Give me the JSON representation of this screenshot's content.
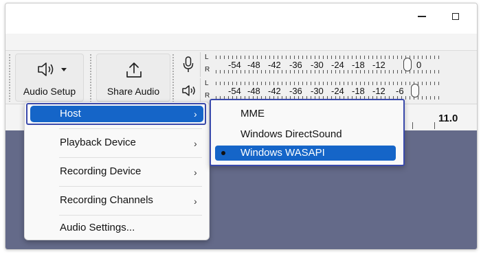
{
  "toolbar": {
    "audio_setup_label": "Audio Setup",
    "share_audio_label": "Share Audio"
  },
  "meters": {
    "channel_left": "L",
    "channel_right": "R",
    "record_scale": [
      "-54",
      "-48",
      "-42",
      "-36",
      "-30",
      "-24",
      "-18",
      "-12",
      "0"
    ],
    "playback_scale": [
      "-54",
      "-48",
      "-42",
      "-36",
      "-30",
      "-24",
      "-18",
      "-12",
      "-6"
    ]
  },
  "ruler": {
    "value": "11.0"
  },
  "menu": {
    "items": [
      {
        "label": "Host",
        "chevron": "›"
      },
      {
        "label": "Playback Device",
        "chevron": "›"
      },
      {
        "label": "Recording Device",
        "chevron": "›"
      },
      {
        "label": "Recording Channels",
        "chevron": "›"
      },
      {
        "label": "Audio Settings..."
      }
    ]
  },
  "host_submenu": {
    "items": [
      {
        "label": "MME"
      },
      {
        "label": "Windows DirectSound"
      },
      {
        "label": "Windows WASAPI",
        "selected": true
      }
    ]
  },
  "icons": {
    "audio_setup": "speaker-icon",
    "share_audio": "upload-icon",
    "record_meter": "microphone-icon",
    "playback_meter": "speaker-icon"
  },
  "colors": {
    "highlight": "#1565c8",
    "callout_border": "#3949ab",
    "track_background": "#646a89"
  }
}
